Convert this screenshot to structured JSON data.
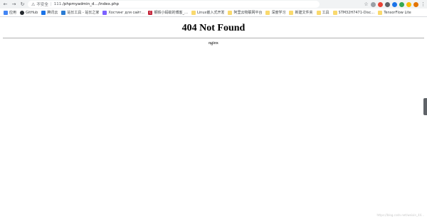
{
  "browser": {
    "nav": {
      "back_icon": "←",
      "forward_icon": "→",
      "reload_icon": "↻",
      "home_icon": "⌂"
    },
    "address_bar": {
      "warning_icon": "warning-triangle",
      "security_label": "不安全",
      "host": "111.",
      "path": "/phpmyadmin_d…/index.php"
    },
    "toolbar_icons": [
      "star-icon",
      "extension-icon",
      "extension-icon",
      "extension-icon",
      "extension-icon",
      "extension-icon",
      "extension-icon",
      "profile-icon",
      "menu-icon"
    ],
    "bookmarks": [
      {
        "label": "应用",
        "icon": "apps-icon",
        "color": "#4285f4"
      },
      {
        "label": "GitHub",
        "icon": "github-icon",
        "color": "#24292e"
      },
      {
        "label": "腾讯云",
        "icon": "cloud-icon",
        "color": "#1a73e8"
      },
      {
        "label": "站长工具 - 站长之家",
        "icon": "site-icon",
        "color": "#2b7cd3"
      },
      {
        "label": "Хостинг для сайт…",
        "icon": "hosting-icon",
        "color": "#7b61ff"
      },
      {
        "label": "钢铁小蚂蚁的博客_…",
        "icon": "csdn-icon",
        "color": "#c32136"
      },
      {
        "label": "Linux嵌入式开发",
        "icon": "folder-icon",
        "color": "#f9d96e"
      },
      {
        "label": "阿里云物联网平台",
        "icon": "folder-icon",
        "color": "#f9d96e"
      },
      {
        "label": "深度学习",
        "icon": "folder-icon",
        "color": "#f9d96e"
      },
      {
        "label": "新建文件夹",
        "icon": "folder-icon",
        "color": "#f9d96e"
      },
      {
        "label": "工具",
        "icon": "folder-icon",
        "color": "#f9d96e"
      },
      {
        "label": "STM32H7471-Disc…",
        "icon": "folder-icon",
        "color": "#f9d96e"
      },
      {
        "label": "TensorFlow Lite",
        "icon": "folder-icon",
        "color": "#f9d96e"
      }
    ]
  },
  "page": {
    "title": "404 Not Found",
    "server": "nginx"
  },
  "footer": {
    "watermark": "https://blog.csdn.net/weixin_44..."
  }
}
